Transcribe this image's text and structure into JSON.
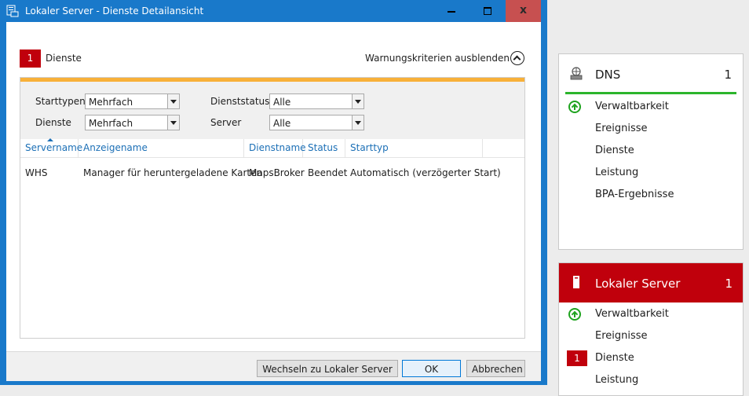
{
  "window": {
    "title": "Lokaler Server - Dienste Detailansicht",
    "close_glyph": "x"
  },
  "criteria": {
    "count": "1",
    "label": "Dienste",
    "hide_label": "Warnungskriterien ausblenden"
  },
  "filters": {
    "starttypen_label": "Starttypen",
    "starttypen_value": "Mehrfach",
    "dienste_label": "Dienste",
    "dienste_value": "Mehrfach",
    "dienststatus_label": "Dienststatus",
    "dienststatus_value": "Alle",
    "server_label": "Server",
    "server_value": "Alle"
  },
  "table": {
    "columns": [
      "Servername",
      "Anzeigename",
      "Dienstname",
      "Status",
      "Starttyp"
    ],
    "rows": [
      [
        "WHS",
        "Manager für heruntergeladene Karten",
        "MapsBroker",
        "Beendet",
        "Automatisch (verzögerter Start)"
      ]
    ]
  },
  "buttons": {
    "switch": "Wechseln zu Lokaler Server",
    "ok": "OK",
    "cancel": "Abbrechen"
  },
  "tiles": {
    "dns": {
      "title": "DNS",
      "count": "1",
      "items": [
        "Verwaltbarkeit",
        "Ereignisse",
        "Dienste",
        "Leistung",
        "BPA-Ergebnisse"
      ]
    },
    "local": {
      "title": "Lokaler Server",
      "count": "1",
      "items": [
        "Verwaltbarkeit",
        "Ereignisse",
        "Dienste",
        "Leistung"
      ],
      "dienste_badge": "1"
    }
  },
  "colors": {
    "accent_blue": "#1979ca",
    "alert_red": "#c0000c",
    "ok_green": "#1fa31f",
    "warning_orange": "#f8b039"
  },
  "icons": [
    "server-icon",
    "dns-server-icon",
    "manageability-ok-icon",
    "collapse-icon",
    "sort-ascending-icon"
  ]
}
